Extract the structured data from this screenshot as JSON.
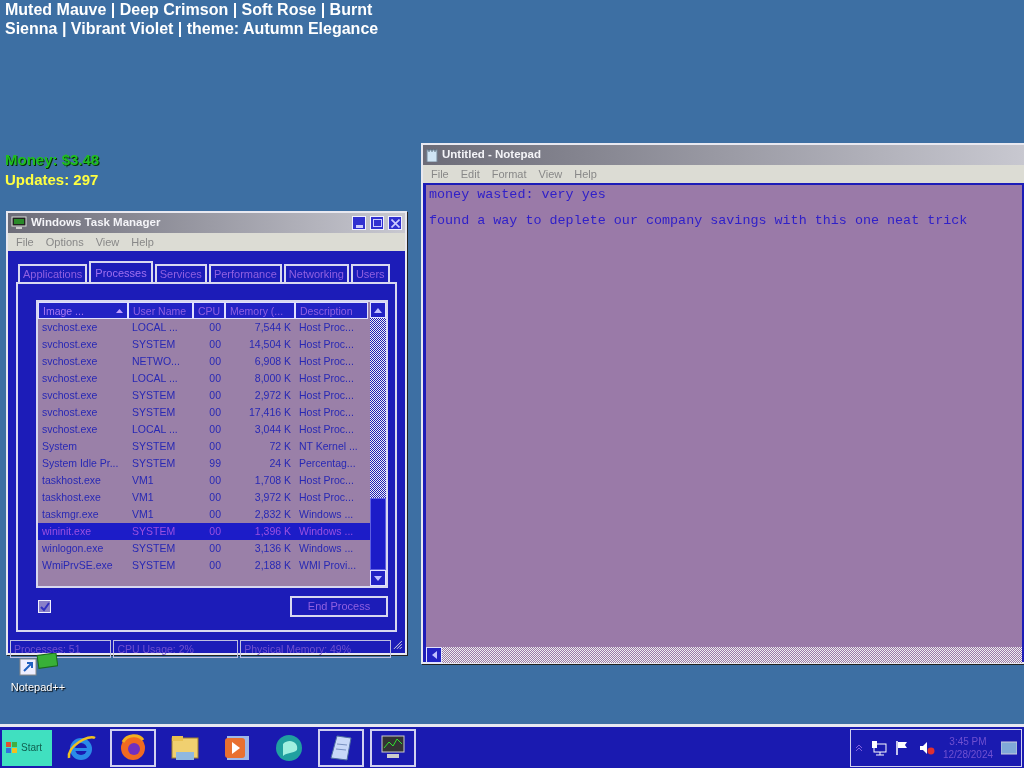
{
  "desktop_caption": "Muted Mauve | Deep Crimson | Soft Rose | Burnt Sienna | Vibrant Violet | theme: Autumn Elegance",
  "stats": [
    {
      "kind": "money",
      "text": "Money: $3.48"
    },
    {
      "kind": "updates",
      "text": "Updates: 297"
    }
  ],
  "task_manager": {
    "title": "Windows Task Manager",
    "menu": [
      "File",
      "Options",
      "View",
      "Help"
    ],
    "tabs": [
      {
        "label": "Applications",
        "selected": false
      },
      {
        "label": "Processes",
        "selected": true
      },
      {
        "label": "Services",
        "selected": false
      },
      {
        "label": "Performance",
        "selected": false
      },
      {
        "label": "Networking",
        "selected": false
      },
      {
        "label": "Users",
        "selected": false
      }
    ],
    "columns": [
      {
        "label": "Image ...",
        "sorted": true
      },
      {
        "label": "User Name",
        "sorted": false
      },
      {
        "label": "CPU",
        "sorted": false
      },
      {
        "label": "Memory (...",
        "sorted": false
      },
      {
        "label": "Description",
        "sorted": false
      }
    ],
    "rows": [
      {
        "cells": [
          "svchost.exe",
          "LOCAL ...",
          "00",
          "7,544 K",
          "Host Proc..."
        ],
        "selected": false
      },
      {
        "cells": [
          "svchost.exe",
          "SYSTEM",
          "00",
          "14,504 K",
          "Host Proc..."
        ],
        "selected": false
      },
      {
        "cells": [
          "svchost.exe",
          "NETWO...",
          "00",
          "6,908 K",
          "Host Proc..."
        ],
        "selected": false
      },
      {
        "cells": [
          "svchost.exe",
          "LOCAL ...",
          "00",
          "8,000 K",
          "Host Proc..."
        ],
        "selected": false
      },
      {
        "cells": [
          "svchost.exe",
          "SYSTEM",
          "00",
          "2,972 K",
          "Host Proc..."
        ],
        "selected": false
      },
      {
        "cells": [
          "svchost.exe",
          "SYSTEM",
          "00",
          "17,416 K",
          "Host Proc..."
        ],
        "selected": false
      },
      {
        "cells": [
          "svchost.exe",
          "LOCAL ...",
          "00",
          "3,044 K",
          "Host Proc..."
        ],
        "selected": false
      },
      {
        "cells": [
          "System",
          "SYSTEM",
          "00",
          "72 K",
          "NT Kernel ..."
        ],
        "selected": false
      },
      {
        "cells": [
          "System Idle Pr...",
          "SYSTEM",
          "99",
          "24 K",
          "Percentag..."
        ],
        "selected": false
      },
      {
        "cells": [
          "taskhost.exe",
          "VM1",
          "00",
          "1,708 K",
          "Host Proc..."
        ],
        "selected": false
      },
      {
        "cells": [
          "taskhost.exe",
          "VM1",
          "00",
          "3,972 K",
          "Host Proc..."
        ],
        "selected": false
      },
      {
        "cells": [
          "taskmgr.exe",
          "VM1",
          "00",
          "2,832 K",
          "Windows ..."
        ],
        "selected": false
      },
      {
        "cells": [
          "wininit.exe",
          "SYSTEM",
          "00",
          "1,396 K",
          "Windows ..."
        ],
        "selected": true
      },
      {
        "cells": [
          "winlogon.exe",
          "SYSTEM",
          "00",
          "3,136 K",
          "Windows ..."
        ],
        "selected": false
      },
      {
        "cells": [
          "WmiPrvSE.exe",
          "SYSTEM",
          "00",
          "2,188 K",
          "WMI Provi..."
        ],
        "selected": false
      }
    ],
    "show_all_checkbox": {
      "checked": true
    },
    "end_process_button": "End Process",
    "status_bar": [
      "Processes: 51",
      "CPU Usage: 2%",
      "Physical Memory: 49%"
    ]
  },
  "notepad": {
    "title": "Untitled - Notepad",
    "menu": [
      "File",
      "Edit",
      "Format",
      "View",
      "Help"
    ],
    "lines": [
      "money wasted: very yes",
      "found a way to deplete our company savings with this one neat trick"
    ]
  },
  "desktop_icons": [
    {
      "label": "Notepad++"
    }
  ],
  "taskbar": {
    "start": "Start",
    "apps": [
      {
        "kind": "ie",
        "pressed": false
      },
      {
        "kind": "firefox",
        "pressed": true
      },
      {
        "kind": "explorer",
        "pressed": false
      },
      {
        "kind": "media",
        "pressed": false
      },
      {
        "kind": "messenger",
        "pressed": false
      },
      {
        "kind": "notepad",
        "pressed": true
      },
      {
        "kind": "taskmgr",
        "pressed": true
      }
    ],
    "time": "3:45 PM",
    "date": "12/28/2024"
  }
}
